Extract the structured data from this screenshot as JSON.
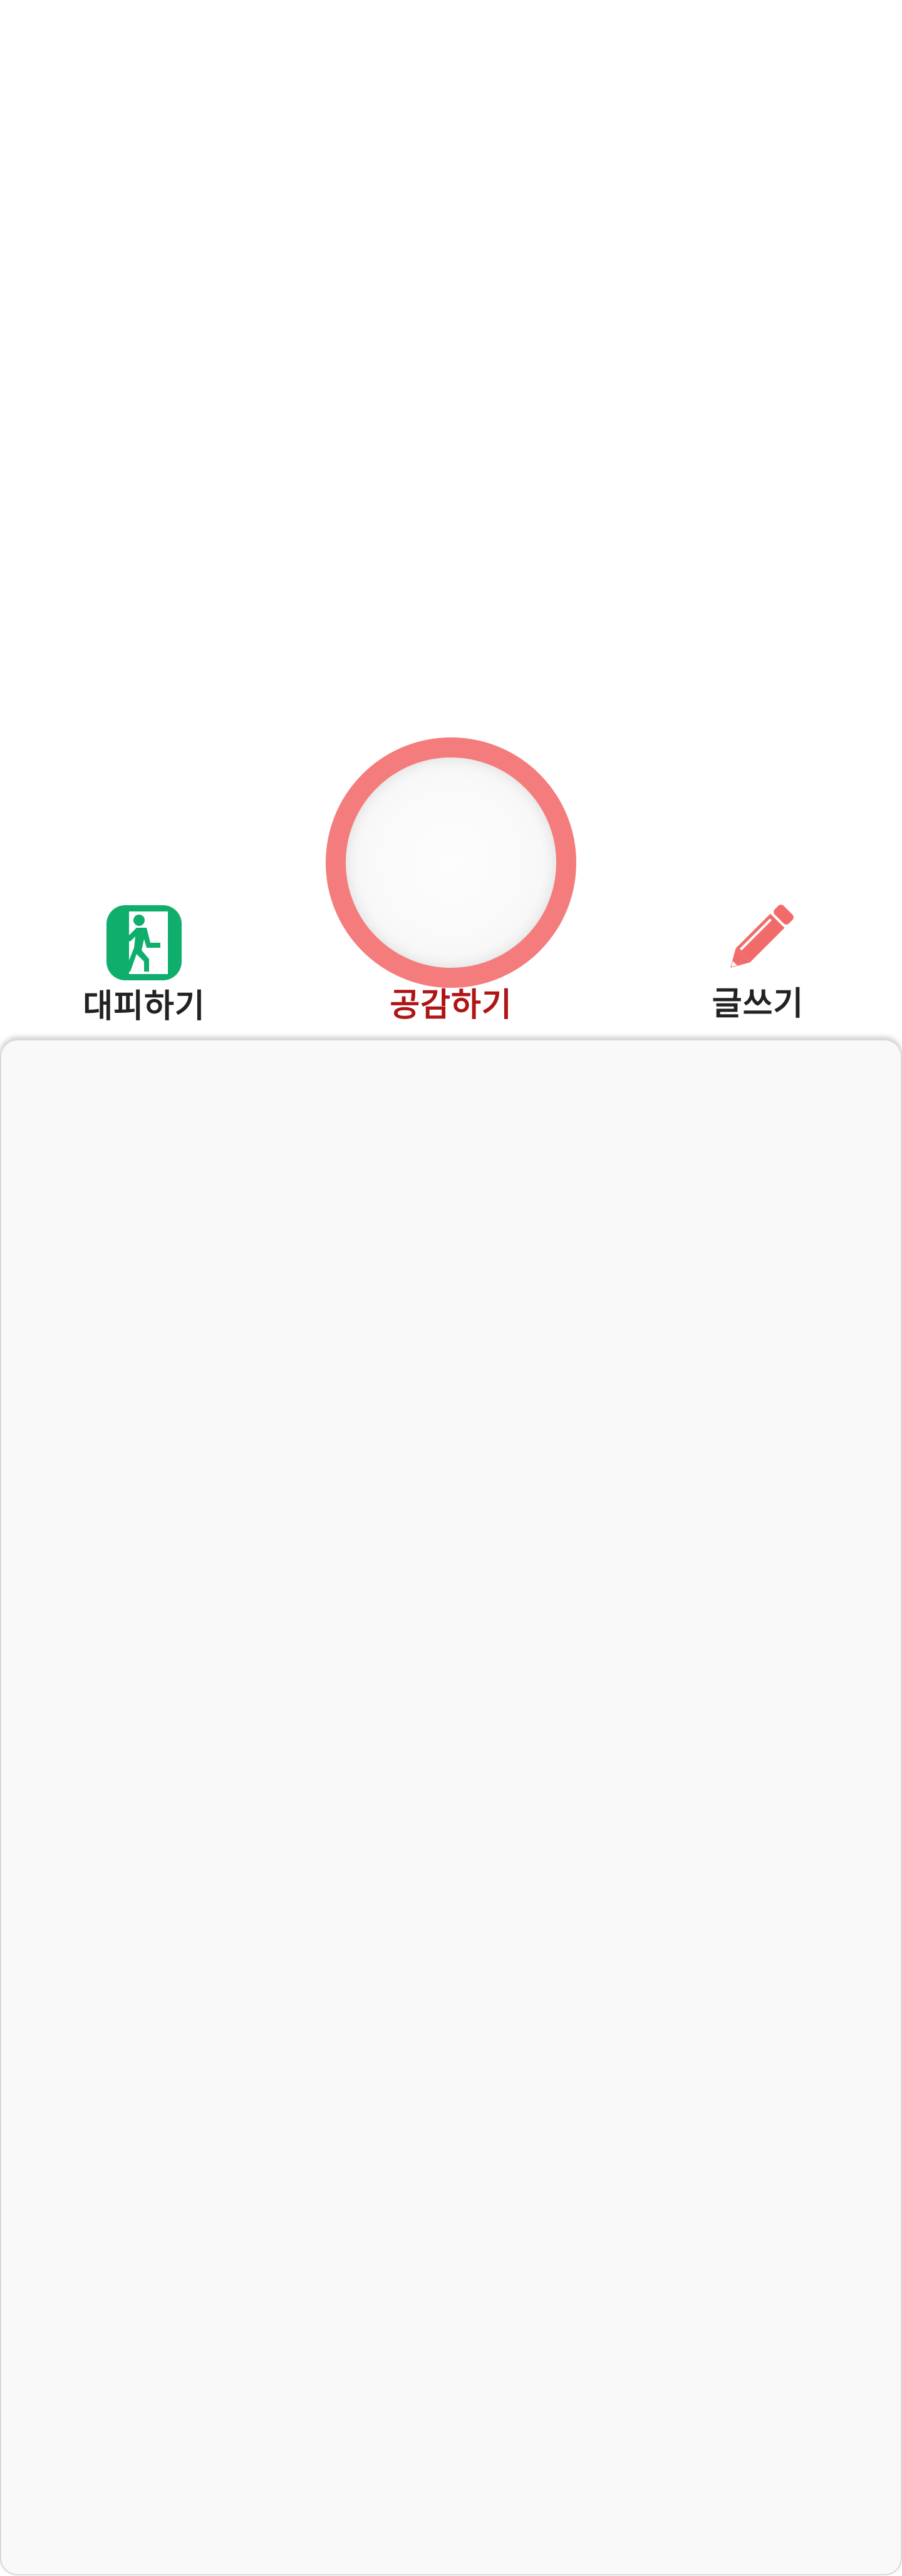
{
  "actions": {
    "evacuate": {
      "label": "대피하기",
      "icon": "emergency-exit-icon"
    },
    "empathize": {
      "label": "공감하기",
      "icon": "circle-button"
    },
    "write": {
      "label": "글쓰기",
      "icon": "pencil-icon"
    }
  },
  "colors": {
    "accent": "#f47c7c",
    "active_label": "#b01414",
    "exit_green": "#0fae6c",
    "panel_background": "#f9f9f9"
  }
}
